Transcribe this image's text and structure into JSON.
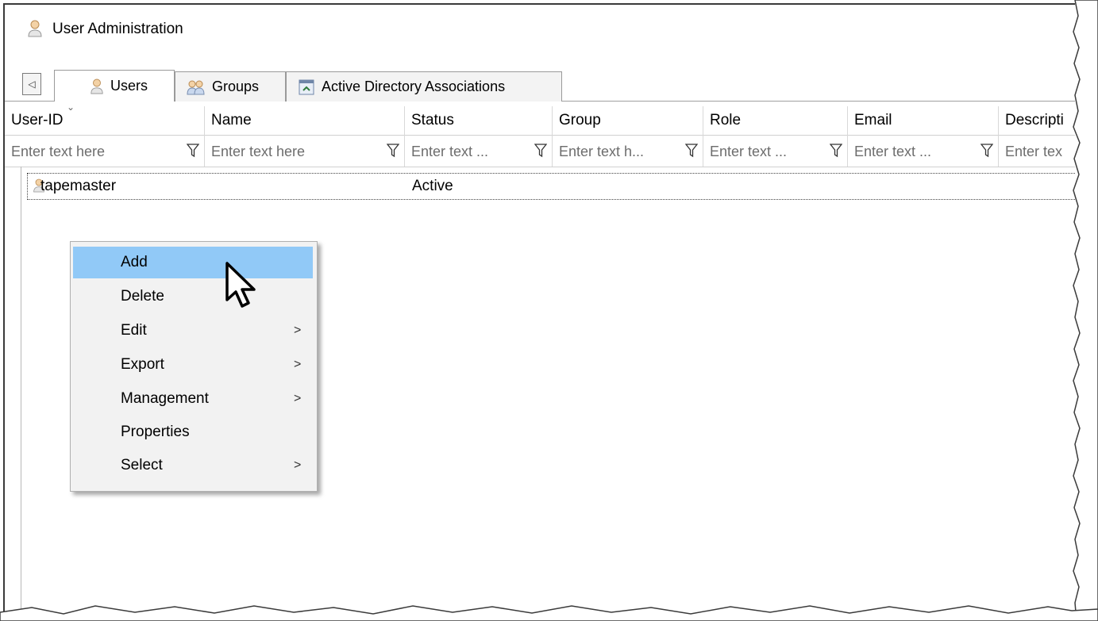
{
  "window": {
    "title": "User Administration"
  },
  "tabs": [
    {
      "label": "Users",
      "icon": "user-icon"
    },
    {
      "label": "Groups",
      "icon": "groups-icon"
    },
    {
      "label": "Active Directory Associations",
      "icon": "ad-association-icon"
    }
  ],
  "columns": [
    "User-ID",
    "Name",
    "Status",
    "Group",
    "Role",
    "Email",
    "Descripti"
  ],
  "filter_placeholders": [
    "Enter text here",
    "Enter text here",
    "Enter text ...",
    "Enter text h...",
    "Enter text ...",
    "Enter text ...",
    "Enter tex"
  ],
  "rows": [
    {
      "user_id": "tapemaster",
      "name": "",
      "status": "Active",
      "group": "",
      "role": "",
      "email": ""
    }
  ],
  "context_menu": {
    "items": [
      {
        "label": "Add",
        "submenu": false,
        "highlighted": true,
        "arrow": ""
      },
      {
        "label": "Delete",
        "submenu": false,
        "arrow": ""
      },
      {
        "label": "Edit",
        "submenu": true,
        "arrow": ">"
      },
      {
        "label": "Export",
        "submenu": true,
        "arrow": ">"
      },
      {
        "label": "Management",
        "submenu": true,
        "arrow": ">"
      },
      {
        "label": "Properties",
        "submenu": false,
        "arrow": ""
      },
      {
        "label": "Select",
        "submenu": true,
        "arrow": ">"
      }
    ]
  },
  "colors": {
    "highlight": "#91c9f7",
    "menu_bg": "#f2f2f2",
    "border": "#3a3a3a"
  }
}
